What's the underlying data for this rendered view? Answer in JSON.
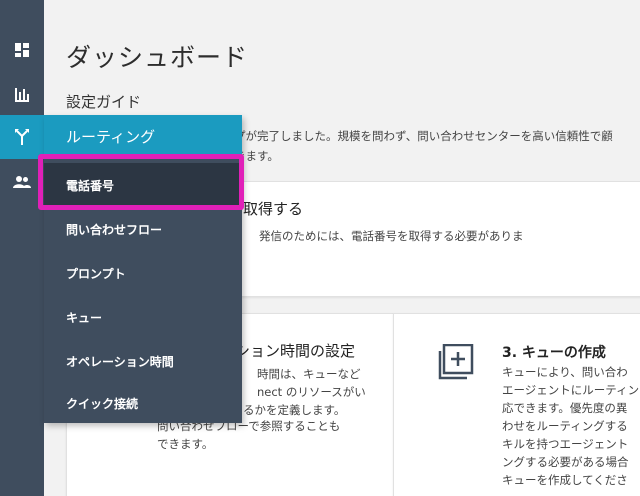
{
  "page": {
    "title": "ダッシュボード",
    "subtitle": "設定ガイド",
    "intro_line1": "プが完了しました。規模を問わず、問い合わせセンターを高い信頼性で顧",
    "intro_line2": "きます。"
  },
  "cards": {
    "phone": {
      "title": "取得する",
      "text": "発信のためには、電話番号を取得する必要がありま"
    },
    "hours": {
      "title": "ション時間の設定",
      "lines": [
        "時間は、キューなど",
        "nect のリソースがい",
        "るかを定義します。",
        "問い合わせフローで参照することも",
        "できます。"
      ]
    },
    "queue": {
      "title": "3. キューの作成",
      "lines": [
        "キューにより、問い合わ",
        "エージェントにルーティン",
        "応できます。優先度の異",
        "わせをルーティングする",
        "キルを持つエージェント",
        "ングする必要がある場合",
        "キューを作成してくださ"
      ]
    }
  },
  "rail": {
    "items": [
      {
        "icon": "dashboard-icon"
      },
      {
        "icon": "metrics-icon"
      },
      {
        "icon": "routing-icon"
      },
      {
        "icon": "users-icon"
      }
    ]
  },
  "menu": {
    "header": "ルーティング",
    "items": [
      "電話番号",
      "問い合わせフロー",
      "プロンプト",
      "キュー",
      "オペレーション時間",
      "クイック接続"
    ],
    "selected_index": 0
  },
  "colors": {
    "rail": "#3f4d5e",
    "accent": "#1b9bc0",
    "highlight": "#e020b8"
  }
}
